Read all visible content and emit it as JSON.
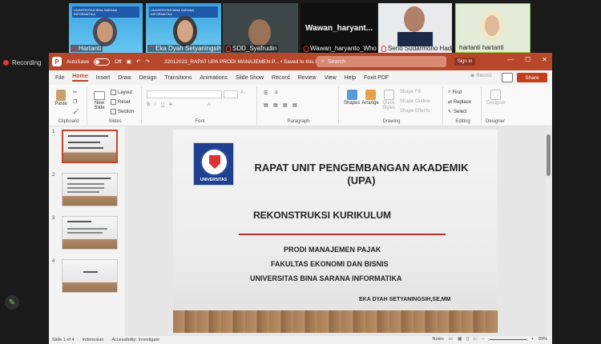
{
  "participants": [
    {
      "name": "Hartanti",
      "banner": "UNIVERSITAS BINA SARANA INFORMATIKA"
    },
    {
      "name": "Eka Dyah Setyaningsih",
      "banner": "UNIVERSITAS BINA SARANA INFORMATIKA"
    },
    {
      "name": "SDD_Syafrudin"
    },
    {
      "name": "Wawan_haryanto_Who",
      "big_name": "Wawan_haryant..."
    },
    {
      "name": "Seno Sudarmono Hadi"
    },
    {
      "name": "hartanti hartanti"
    }
  ],
  "recording_label": "Recording",
  "ppt": {
    "autosave_label": "AutoSave",
    "autosave_state": "Off",
    "file_title": "22012023_RAPAT UPA PRODI MANAJEMEN P... • Saved to this PC ˅",
    "search_placeholder": "Search",
    "signin": "Sign in",
    "record_label": "Record",
    "share_label": "Share",
    "menu": [
      "File",
      "Home",
      "Insert",
      "Draw",
      "Design",
      "Transitions",
      "Animations",
      "Slide Show",
      "Record",
      "Review",
      "View",
      "Help",
      "Foxit PDF"
    ],
    "active_menu": "Home",
    "ribbon": {
      "clipboard": {
        "label": "Clipboard",
        "paste": "Paste"
      },
      "slides": {
        "label": "Slides",
        "new_slide": "New Slide",
        "layout": "Layout",
        "reset": "Reset",
        "section": "Section"
      },
      "font": {
        "label": "Font"
      },
      "paragraph": {
        "label": "Paragraph"
      },
      "drawing": {
        "label": "Drawing",
        "shapes": "Shapes",
        "arrange": "Arrange",
        "quick_styles": "Quick Styles",
        "shape_fill": "Shape Fill",
        "shape_outline": "Shape Outline",
        "shape_effects": "Shape Effects"
      },
      "editing": {
        "label": "Editing",
        "find": "Find",
        "replace": "Replace",
        "select": "Select"
      },
      "designer": {
        "label": "Designer",
        "btn": "Designer"
      }
    },
    "thumb_numbers": [
      "1",
      "2",
      "3",
      "4"
    ],
    "slide": {
      "logo_text": "UNIVERSITAS",
      "title": "RAPAT UNIT PENGEMBANGAN AKADEMIK (UPA)",
      "subtitle": "REKONSTRUKSI KURIKULUM",
      "line1": "PRODI MANAJEMEN PAJAK",
      "line2": "FAKULTAS EKONOMI DAN BISNIS",
      "line3": "UNIVERSITAS BINA SARANA INFORMATIKA",
      "author": "EKA DYAH SETYANINGSIH,SE,MM"
    },
    "status": {
      "slide_count": "Slide 1 of 4",
      "language": "Indonesian",
      "accessibility": "Accessibility: Investigate",
      "notes": "Notes",
      "zoom": "89%"
    }
  }
}
